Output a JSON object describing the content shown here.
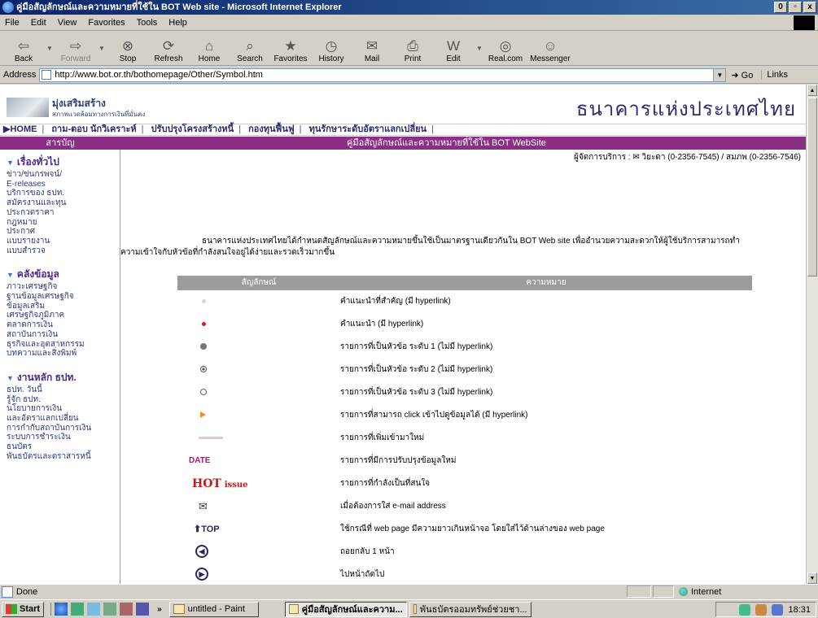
{
  "window": {
    "title": "คู่มือสัญลักษณ์และความหมายที่ใช้ใน BOT Web site - Microsoft Internet Explorer",
    "min": "0",
    "max": "▫",
    "close": "x"
  },
  "menu": [
    "File",
    "Edit",
    "View",
    "Favorites",
    "Tools",
    "Help"
  ],
  "toolbar": [
    {
      "label": "Back",
      "icon": "back-arrow",
      "glyph": "⇦"
    },
    {
      "label": "Forward",
      "icon": "forward-arrow",
      "glyph": "⇨",
      "disabled": true
    },
    {
      "label": "Stop",
      "icon": "stop",
      "glyph": "⊗"
    },
    {
      "label": "Refresh",
      "icon": "refresh",
      "glyph": "⟳"
    },
    {
      "label": "Home",
      "icon": "home",
      "glyph": "⌂"
    },
    {
      "label": "Search",
      "icon": "search",
      "glyph": "⌕"
    },
    {
      "label": "Favorites",
      "icon": "favorites",
      "glyph": "★"
    },
    {
      "label": "History",
      "icon": "history",
      "glyph": "◷"
    },
    {
      "label": "Mail",
      "icon": "mail",
      "glyph": "✉"
    },
    {
      "label": "Print",
      "icon": "print",
      "glyph": "⎙"
    },
    {
      "label": "Edit",
      "icon": "edit",
      "glyph": "W"
    },
    {
      "label": "Real.com",
      "icon": "realcom",
      "glyph": "◎"
    },
    {
      "label": "Messenger",
      "icon": "messenger",
      "glyph": "☺"
    }
  ],
  "address": {
    "label": "Address",
    "url": "http://www.bot.or.th/bothomepage/Other/Symbol.htm",
    "go": "Go",
    "links": "Links"
  },
  "site": {
    "promo_title": "มุ่งเสริมสร้าง",
    "promo_sub": "สภาพแวดล้อมทางการเงินที่มั่นคง",
    "logo_text": "ธนาคารแห่งประเทศไทย",
    "nav": [
      "HOME",
      "ถาม-ตอบ นักวิเคราะห์",
      "ปรับปรุงโครงสร้างหนี้",
      "กองทุนฟื้นฟู",
      "ทุนรักษาระดับอัตราแลกเปลี่ยน"
    ],
    "toc_label": "สารบัญ",
    "page_title": "คู่มือสัญลักษณ์และความหมายที่ใช้ใน BOT WebSite",
    "contact": "ผู้จัดการบริการ : ✉ วิยะดา (0-2356-7545) / สมภพ (0-2356-7546)",
    "intro_line1": "ธนาคารแห่งประเทศไทยได้กำหนดสัญลักษณ์และความหมายขึ้นใช้เป็นมาตรฐานเดียวกันใน BOT Web site เพื่ออำนวยความสะดวกให้ผู้ใช้บริการสามารถทำ",
    "intro_line2": "ความเข้าใจกับหัวข้อที่กำลังสนใจอยู่ได้ง่ายและรวดเร็วมากขึ้น"
  },
  "sidebar": {
    "sections": [
      {
        "title": "เรื่องทั่วไป",
        "items": [
          "ข่าว/ข่นกรพจน์/",
          "E-releases",
          "บริการของ ธปท.",
          "สมัครงานและทุน",
          "ประกวดราคา",
          "กฎหมาย",
          "ประกาศ",
          "แบบรายงาน",
          "แบบสำรวจ"
        ]
      },
      {
        "title": "คลังข้อมูล",
        "items": [
          "ภาวะเศรษฐกิจ",
          "ฐานข้อมูลเศรษฐกิจ",
          "ข้อมูลเสริม",
          "เศรษฐกิจภูมิภาค",
          "ตลาดการเงิน",
          "สถาบันการเงิน",
          "ธุรกิจและอุตสาหกรรม",
          "บทความและสิ่งพิมพ์"
        ]
      },
      {
        "title": "งานหลัก ธปท.",
        "items": [
          "ธปท. วันนี้",
          "รู้จัก ธปท.",
          "นโยบายการเงิน",
          "และอัตราแลกเปลี่ยน",
          "การกำกับสถาบันการเงิน",
          "ระบบการชำระเงิน",
          "ธนบัตร",
          "พันธบัตรและตราสารหนี้"
        ]
      }
    ]
  },
  "legend": {
    "col_symbol": "สัญลักษณ์",
    "col_meaning": "ความหมาย",
    "rows": [
      {
        "symbol": "faint-bullet",
        "meaning": "คำแนะนำที่สำคัญ (มี hyperlink)"
      },
      {
        "symbol": "red-bullet",
        "meaning": "คำแนะนำ (มี hyperlink)"
      },
      {
        "symbol": "filled-circle",
        "meaning": "รายการที่เป็นหัวข้อ ระดับ 1 (ไม่มี hyperlink)"
      },
      {
        "symbol": "bullseye",
        "meaning": "รายการที่เป็นหัวข้อ ระดับ 2 (ไม่มี hyperlink)"
      },
      {
        "symbol": "open-circle",
        "meaning": "รายการที่เป็นหัวข้อ ระดับ 3 (ไม่มี hyperlink)"
      },
      {
        "symbol": "orange-triangle",
        "meaning": "รายการที่สามารถ click เข้าไปดูข้อมูลได้ (มี hyperlink)"
      },
      {
        "symbol": "new-marker",
        "meaning": "รายการที่เพิ่มเข้ามาใหม่"
      },
      {
        "symbol": "update-marker",
        "meaning": "รายการที่มีการปรับปรุงข้อมูลใหม่",
        "text": "DATE"
      },
      {
        "symbol": "hot-issue",
        "meaning": "รายการที่กำลังเป็นที่สนใจ",
        "text": "HOT",
        "text2": "issue"
      },
      {
        "symbol": "envelope",
        "meaning": "เมื่อต้องการใส่ e-mail address",
        "text": "✉"
      },
      {
        "symbol": "top-button",
        "meaning": "ใช้กรณีที่ web page มีความยาวเกินหน้าจอ โดยใส่ไว้ด้านล่างของ web page",
        "text": "TOP"
      },
      {
        "symbol": "back-circle",
        "meaning": "ถอยกลับ 1 หน้า",
        "text": "◀"
      },
      {
        "symbol": "next-circle",
        "meaning": "ไปหน้าถัดไป",
        "text": "▶"
      }
    ]
  },
  "status": {
    "text": "Done",
    "zone": "Internet"
  },
  "taskbar": {
    "start": "Start",
    "tasks": [
      "untitled - Paint",
      "คู่มือสัญลักษณ์และความ...",
      "พันธบัตรออมทรัพย์ช่วยชา..."
    ],
    "clock": "18:31"
  }
}
